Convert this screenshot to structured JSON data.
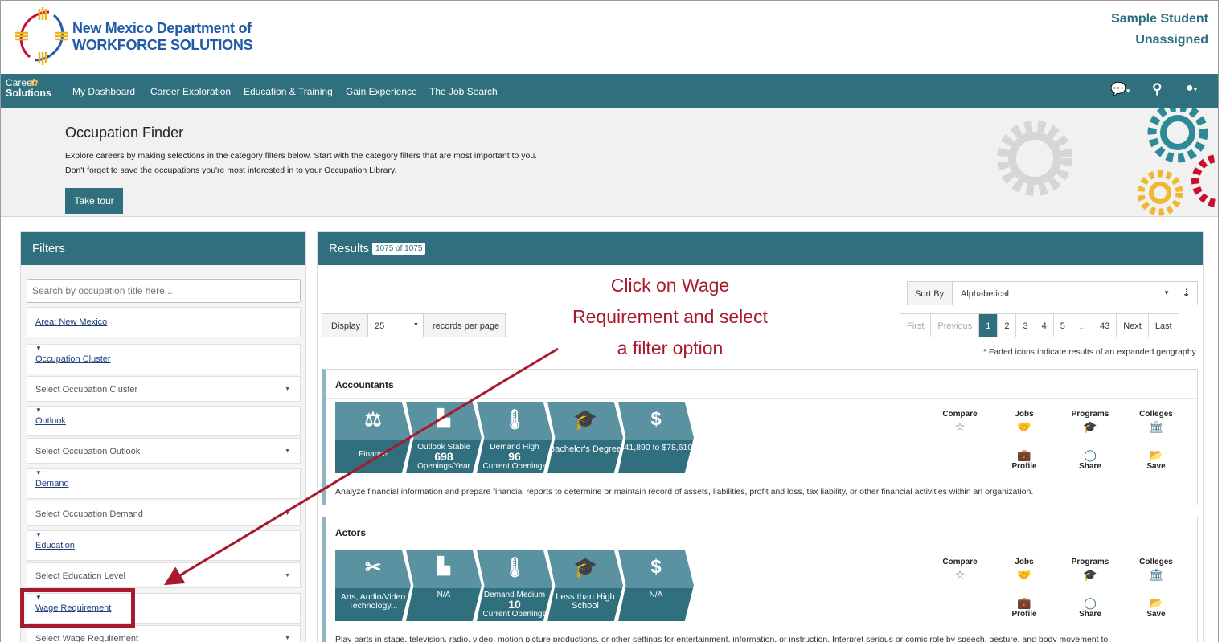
{
  "header": {
    "org_line1": "New Mexico Department of",
    "org_line2": "WORKFORCE SOLUTIONS",
    "user_name": "Sample Student",
    "user_status": "Unassigned"
  },
  "nav": {
    "brand_line1": "Career",
    "brand_line2": "Solutions",
    "items": [
      "My Dashboard",
      "Career Exploration",
      "Education & Training",
      "Gain Experience",
      "The Job Search"
    ],
    "icons": [
      "chat-icon",
      "search-icon",
      "user-icon"
    ]
  },
  "banner": {
    "title": "Occupation Finder",
    "line1": "Explore careers by making selections in the category filters below. Start with the category filters that are most important to you.",
    "line2": "Don't forget to save the occupations you're most interested in to your Occupation Library.",
    "tour_button": "Take tour"
  },
  "filters": {
    "title": "Filters",
    "search_placeholder": "Search by occupation title here...",
    "area_link": "Area: New Mexico",
    "groups": [
      {
        "label": "Occupation Cluster",
        "select": "Select Occupation Cluster"
      },
      {
        "label": "Outlook",
        "select": "Select Occupation Outlook"
      },
      {
        "label": "Demand",
        "select": "Select Occupation Demand"
      },
      {
        "label": "Education",
        "select": "Select Education Level"
      },
      {
        "label": "Wage Requirement",
        "select": "Select Wage Requirement"
      }
    ]
  },
  "results": {
    "title": "Results",
    "count_badge": "1075 of 1075",
    "display_label": "Display",
    "display_value": "25",
    "records_label": "records per page",
    "sort_label": "Sort By:",
    "sort_value": "Alphabetical",
    "pager": [
      "First",
      "Previous",
      "1",
      "2",
      "3",
      "4",
      "5",
      "...",
      "43",
      "Next",
      "Last"
    ],
    "faded_note": "* Faded icons indicate results of an expanded geography.",
    "cards": [
      {
        "title": "Accountants",
        "chevrons": [
          {
            "icon": "scale-icon",
            "text": "Finance",
            "sub": "",
            "big": ""
          },
          {
            "icon": "chart-icon",
            "text": "Outlook Stable",
            "big": "698",
            "sub": "Openings/Year"
          },
          {
            "icon": "thermometer-icon",
            "text": "Demand High",
            "big": "96",
            "sub": "Current Openings"
          },
          {
            "icon": "graduation-cap-icon",
            "text": "Bachelor's Degree",
            "big": "",
            "sub": ""
          },
          {
            "icon": "dollar-icon",
            "text": "$41,890 to $78,610",
            "big": "",
            "sub": ""
          }
        ],
        "description": "Analyze financial information and prepare financial reports to determine or maintain record of assets, liabilities, profit and loss, tax liability, or other financial activities within an organization."
      },
      {
        "title": "Actors",
        "chevrons": [
          {
            "icon": "tools-icon",
            "text": "Arts, Audio/Video Technology...",
            "big": "",
            "sub": ""
          },
          {
            "icon": "chart-icon",
            "text": "N/A",
            "big": "",
            "sub": ""
          },
          {
            "icon": "thermometer-icon",
            "text": "Demand Medium",
            "big": "10",
            "sub": "Current Openings"
          },
          {
            "icon": "graduation-cap-icon",
            "text": "Less than High School",
            "big": "",
            "sub": ""
          },
          {
            "icon": "dollar-icon",
            "text": "N/A",
            "big": "",
            "sub": ""
          }
        ],
        "description": "Play parts in stage, television, radio, video, motion picture productions, or other settings for entertainment, information, or instruction. Interpret serious or comic role by speech, gesture, and body movement to"
      }
    ],
    "actions": {
      "compare": "Compare",
      "jobs": "Jobs",
      "programs": "Programs",
      "colleges": "Colleges",
      "profile": "Profile",
      "share": "Share",
      "save": "Save"
    }
  },
  "annotation": {
    "line1": "Click on Wage",
    "line2": "Requirement and select",
    "line3": "a filter option"
  },
  "colors": {
    "primary": "#2f6f7e",
    "chevron_top": "#5b92a1",
    "annotation": "#a8192e",
    "link": "#1f3f7a"
  }
}
